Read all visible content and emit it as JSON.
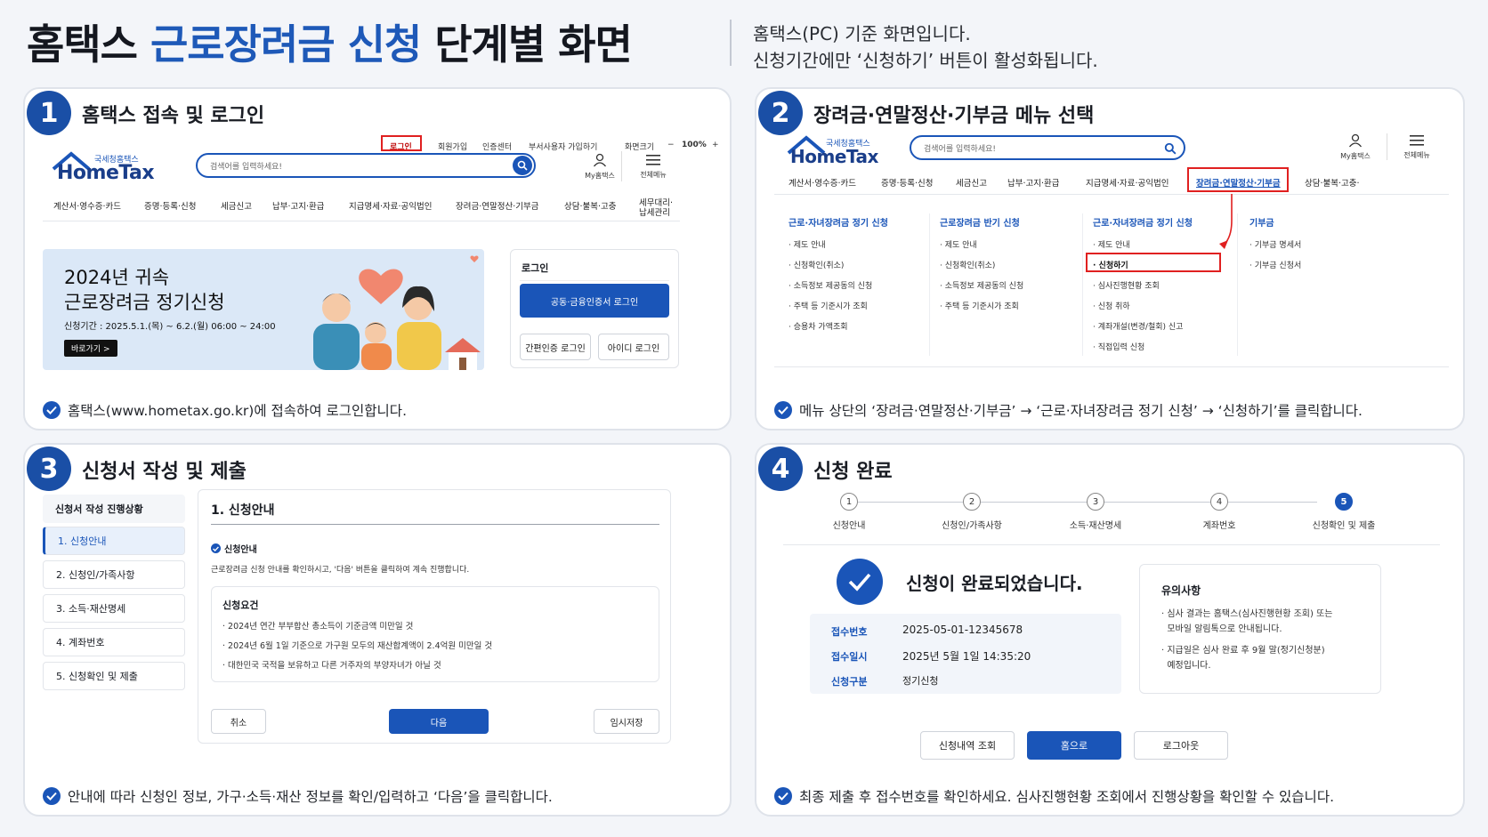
{
  "header": {
    "title_part1": "홈택스 ",
    "title_highlight": "근로장려금 신청",
    "title_part2": " 단계별 화면",
    "sub1": "홈택스(PC) 기준 화면입니다.",
    "sub2": "신청기간에만 ‘신청하기’ 버튼이 활성화됩니다."
  },
  "logo": {
    "small": "국세청홈택스",
    "main": "HomeTax"
  },
  "panel1": {
    "num": "1",
    "title": "홈택스 접속 및 로그인",
    "top_links": [
      "로그인",
      "회원가입",
      "인증센터",
      "부서사용자 가입하기",
      "화면크기",
      "−",
      "100%",
      "+"
    ],
    "search_placeholder": "검색어를 입력하세요!",
    "my_label": "My홈택스",
    "all_menu_label": "전체메뉴",
    "menu": [
      "계산서·영수증·카드",
      "증명·등록·신청",
      "세금신고",
      "납부·고지·환급",
      "지급명세·자료·공익법인",
      "장려금·연말정산·기부금",
      "상담·불복·고충",
      "세무대리·",
      "납세관리"
    ],
    "banner_line1": "2024년 귀속",
    "banner_line2": "근로장려금 정기신청",
    "banner_period": "신청기간 : 2025.5.1.(목) ~ 6.2.(월) 06:00 ~ 24:00",
    "banner_btn": "바로가기 >",
    "login_title": "로그인",
    "login_cert": "공동·금융인증서 로그인",
    "login_simple": "간편인증 로그인",
    "login_id": "아이디 로그인",
    "caption": "홈택스(www.hometax.go.kr)에 접속하여 로그인합니다."
  },
  "panel2": {
    "num": "2",
    "title": "장려금·연말정산·기부금 메뉴 선택",
    "search_placeholder": "검색어를 입력하세요!",
    "my_label": "My홈택스",
    "all_menu_label": "전체메뉴",
    "menu": [
      "계산서·영수증·카드",
      "증명·등록·신청",
      "세금신고",
      "납부·고지·환급",
      "지급명세·자료·공익법인",
      "장려금·연말정산·기부금",
      "상담·불복·고충·"
    ],
    "columns": [
      {
        "head": "근로·자녀장려금 정기 신청",
        "items": [
          "· 제도 안내",
          "· 신청확인(취소)",
          "· 소득정보 제공동의 신청",
          "· 주택 등 기준시가 조회",
          "· 승용차 가액조회"
        ]
      },
      {
        "head": "근로장려금 반기 신청",
        "items": [
          "· 제도 안내",
          "· 신청확인(취소)",
          "· 소득정보 제공동의 신청",
          "· 주택 등 기준시가 조회"
        ]
      },
      {
        "head": "근로·자녀장려금 정기 신청",
        "items": [
          "· 제도 안내",
          "· 신청하기",
          "· 심사진행현황 조회",
          "· 신청 취하",
          "· 계좌개설(변경/철회) 신고",
          "· 직접입력 신청"
        ]
      },
      {
        "head": "기부금",
        "items": [
          "· 기부금 명세서",
          "· 기부금 신청서"
        ]
      }
    ],
    "caption": "메뉴 상단의 ‘장려금·연말정산·기부금’ → ‘근로·자녀장려금 정기 신청’ → ‘신청하기’를 클릭합니다."
  },
  "panel3": {
    "num": "3",
    "title": "신청서 작성 및 제출",
    "side_head": "신청서 작성 진행상황",
    "side_items": [
      "1. 신청안내",
      "2. 신청인/가족사항",
      "3. 소득·재산명세",
      "4. 계좌번호",
      "5. 신청확인 및 제출"
    ],
    "form_title": "1. 신청안내",
    "guide_title": "신청안내",
    "guide_text": "근로장려금 신청 안내를 확인하시고, '다음' 버튼을 클릭하여 계속 진행합니다.",
    "req_title": "신청요건",
    "req_items": [
      "· 2024년 연간 부부합산 총소득이 기준금액 미만일 것",
      "· 2024년 6월 1일 기준으로 가구원 모두의 재산합계액이 2.4억원 미만일 것",
      "· 대한민국 국적을 보유하고 다른 거주자의 부양자녀가 아닐 것"
    ],
    "btn_cancel": "취소",
    "btn_next": "다음",
    "btn_save": "임시저장",
    "caption": "안내에 따라 신청인 정보, 가구·소득·재산 정보를 확인/입력하고 ‘다음’을 클릭합니다."
  },
  "panel4": {
    "num": "4",
    "title": "신청 완료",
    "steps": [
      {
        "n": "1",
        "label": "신청안내"
      },
      {
        "n": "2",
        "label": "신청인/가족사항"
      },
      {
        "n": "3",
        "label": "소득·재산명세"
      },
      {
        "n": "4",
        "label": "계좌번호"
      },
      {
        "n": "5",
        "label": "신청확인 및 제출"
      }
    ],
    "done_msg": "신청이 완료되었습니다.",
    "rows": [
      {
        "k": "접수번호",
        "v": "2025-05-01-12345678"
      },
      {
        "k": "접수일시",
        "v": "2025년 5월 1일 14:35:20"
      },
      {
        "k": "신청구분",
        "v": "정기신청"
      }
    ],
    "notice_title": "유의사항",
    "notice_items": [
      "· 심사 결과는 홈택스(심사진행현황 조회) 또는",
      "  모바일 알림톡으로 안내됩니다.",
      "· 지급일은 심사 완료 후 9월 말(정기신청분)",
      "  예정입니다."
    ],
    "btn_history": "신청내역 조회",
    "btn_home": "홈으로",
    "btn_logout": "로그아웃",
    "caption": "최종 제출 후 접수번호를 확인하세요. 심사진행현황 조회에서 진행상황을 확인할 수 있습니다."
  },
  "colors": {
    "accent": "#1a55b8",
    "highlight_red": "#e02020",
    "title_blue": "#1e59b8"
  }
}
